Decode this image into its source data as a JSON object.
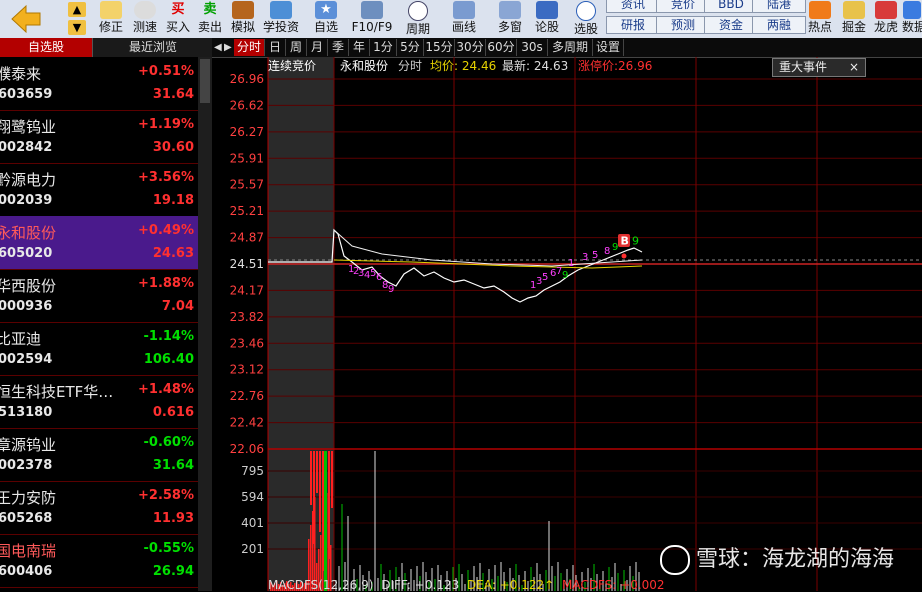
{
  "toolbar": {
    "buttons": [
      {
        "label": "",
        "icon": "back-arrow-icon"
      },
      {
        "label": "修正",
        "icon": "edit-icon"
      },
      {
        "label": "测速",
        "icon": "speed-icon"
      },
      {
        "label": "买入",
        "icon": "buy-icon",
        "glyph": "买"
      },
      {
        "label": "卖出",
        "icon": "sell-icon",
        "glyph": "卖"
      },
      {
        "label": "模拟",
        "icon": "hammer-icon"
      },
      {
        "label": "学投资",
        "icon": "learn-icon"
      },
      {
        "label": "自选",
        "icon": "star-icon"
      },
      {
        "label": "F10/F9",
        "icon": "f10-icon"
      },
      {
        "label": "周期",
        "icon": "clock-icon"
      },
      {
        "label": "画线",
        "icon": "draw-icon"
      },
      {
        "label": "多窗",
        "icon": "windows-icon"
      },
      {
        "label": "论股",
        "icon": "forum-icon"
      },
      {
        "label": "选股",
        "icon": "select-icon"
      },
      {
        "label": "热点",
        "icon": "hot-icon"
      },
      {
        "label": "掘金",
        "icon": "gold-icon"
      },
      {
        "label": "龙虎",
        "icon": "dragon-icon"
      },
      {
        "label": "数据",
        "icon": "data-icon"
      }
    ],
    "small_buttons": [
      "资讯",
      "竞价",
      "BBD",
      "陆港",
      "研报",
      "预测",
      "资金",
      "两融"
    ]
  },
  "sidebar": {
    "tabs": [
      "自选股",
      "最近浏览"
    ],
    "stocks": [
      {
        "name": "濮泰来",
        "code": "603659",
        "change": "+0.51%",
        "price": "31.64",
        "up": true
      },
      {
        "name": "翔鹭钨业",
        "code": "002842",
        "change": "+1.19%",
        "price": "30.60",
        "up": true
      },
      {
        "name": "黔源电力",
        "code": "002039",
        "change": "+3.56%",
        "price": "19.18",
        "up": true
      },
      {
        "name": "永和股份",
        "code": "605020",
        "change": "+0.49%",
        "price": "24.63",
        "up": true,
        "selected": true
      },
      {
        "name": "华西股份",
        "code": "000936",
        "change": "+1.88%",
        "price": "7.04",
        "up": true
      },
      {
        "name": "比亚迪",
        "code": "002594",
        "change": "-1.14%",
        "price": "106.40",
        "up": false
      },
      {
        "name": "恒生科技ETF华…",
        "code": "513180",
        "change": "+1.48%",
        "price": "0.616",
        "up": true
      },
      {
        "name": "章源钨业",
        "code": "002378",
        "change": "-0.60%",
        "price": "31.64",
        "up": false
      },
      {
        "name": "王力安防",
        "code": "605268",
        "change": "+2.58%",
        "price": "11.93",
        "up": true
      },
      {
        "name": "国电南瑞",
        "code": "600406",
        "change": "-0.55%",
        "price": "26.94",
        "up": false
      }
    ]
  },
  "periods": [
    "分时",
    "日",
    "周",
    "月",
    "季",
    "年",
    "1分",
    "5分",
    "15分",
    "30分",
    "60分",
    "30s",
    "多周期",
    "设置"
  ],
  "active_period": "分时",
  "chart_header": {
    "auction": "连续竞价",
    "stock_name": "永和股份",
    "mode": "分时",
    "avg_label": "均价: 24.46",
    "latest_label": "最新: 24.63",
    "limit_label": "涨停价:26.96",
    "event_button": "重大事件",
    "event_close": "×"
  },
  "price_axis": [
    "26.96",
    "26.62",
    "26.27",
    "25.91",
    "25.57",
    "25.21",
    "24.87",
    "24.51",
    "24.17",
    "23.82",
    "23.46",
    "23.12",
    "22.76",
    "22.42",
    "22.06"
  ],
  "volume_axis": [
    "795",
    "594",
    "401",
    "201"
  ],
  "macd": {
    "title": "MACDFS(12,26,9)",
    "diff": "DIFF: +0.123",
    "dea": "DEA: +0.122↑",
    "macdfs": "MACDFS: +0.002"
  },
  "signal_badge": "B",
  "watermark": "雪球：海龙湖的海海",
  "colors": {
    "up": "#ff3030",
    "down": "#00e000",
    "accent": "#b30000",
    "avg": "#e6d200",
    "price_line": "#ffffff",
    "selected_row": "#4a1a8c"
  }
}
